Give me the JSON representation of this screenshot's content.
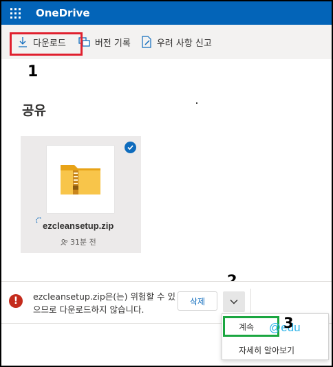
{
  "header": {
    "app_title": "OneDrive",
    "waffle_icon": "waffle-grid-icon",
    "bar_color": "#0364b8"
  },
  "commandbar": {
    "download_label": "다운로드",
    "version_history_label": "버전 기록",
    "report_label": "우려 사항 신고"
  },
  "annotations": {
    "step1": "1",
    "step2": "2",
    "step3": "3",
    "highlight_red": "#e0202e",
    "highlight_green": "#1aa640",
    "watermark": "@edu"
  },
  "main": {
    "section_title": "공유",
    "file": {
      "name": "ezcleansetup.zip",
      "modified": "31분 전",
      "selected": true
    }
  },
  "warning": {
    "message": "ezcleansetup.zip은(는) 위험할 수 있으므로 다운로드하지 않습니다.",
    "delete_label": "삭제"
  },
  "menu": {
    "continue_label": "계속",
    "learn_more_label": "자세히 알아보기"
  }
}
